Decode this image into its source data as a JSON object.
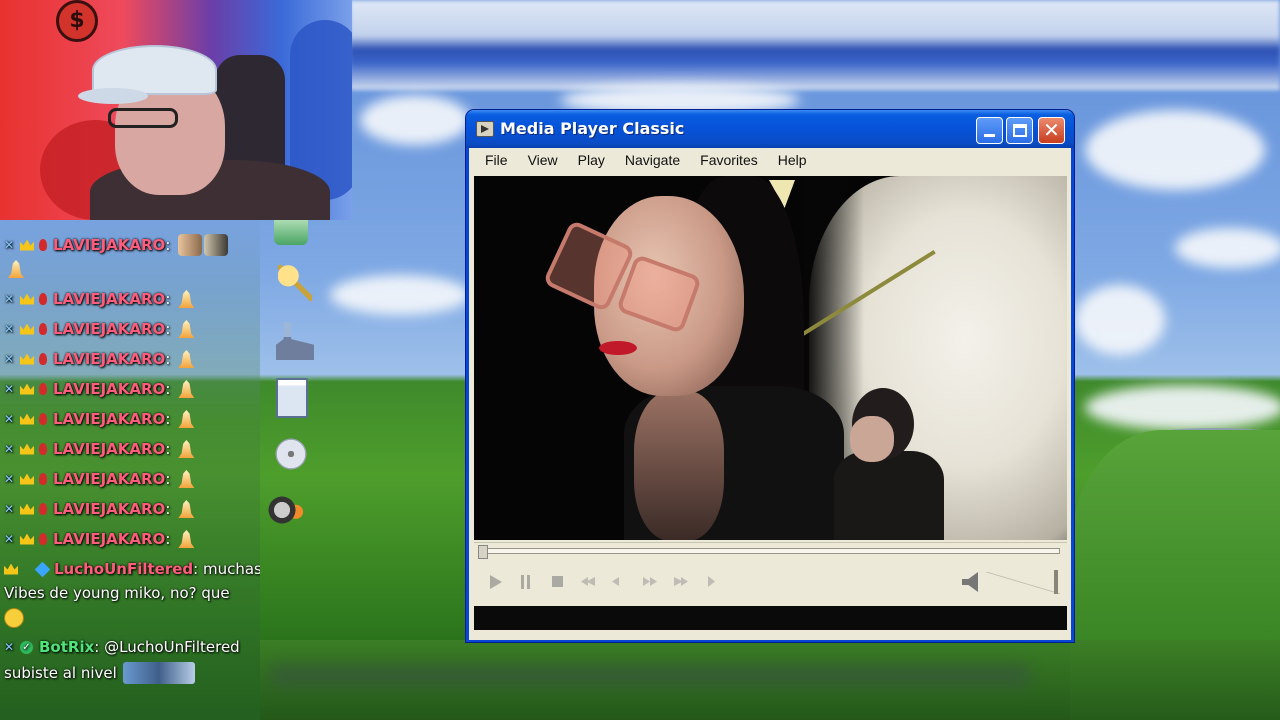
{
  "webcam": {
    "coin_symbol": "$"
  },
  "chat": {
    "messages": [
      {
        "user": "LAVIEJAKARO",
        "text": ""
      },
      {
        "user": "LAVIEJAKARO",
        "text": ""
      },
      {
        "user": "LAVIEJAKARO",
        "text": ""
      },
      {
        "user": "LAVIEJAKARO",
        "text": ""
      },
      {
        "user": "LAVIEJAKARO",
        "text": ""
      },
      {
        "user": "LAVIEJAKARO",
        "text": ""
      },
      {
        "user": "LAVIEJAKARO",
        "text": ""
      },
      {
        "user": "LAVIEJAKARO",
        "text": ""
      },
      {
        "user": "LAVIEJAKARO",
        "text": ""
      },
      {
        "user": "LAVIEJAKARO",
        "text": ""
      },
      {
        "user": "LuchoUnFiltered",
        "text": "muchas",
        "text_line2": "Vibes de young miko, no? que"
      },
      {
        "user": "BotRix",
        "text": "@LuchoUnFiltered",
        "text_line2": "subiste al nivel"
      }
    ],
    "colors": {
      "user": "#ff5b7a",
      "bot": "#50e37a"
    }
  },
  "desktop_icons": [
    "recycle-icon",
    "keys-icon",
    "phone-icon",
    "notepad-icon",
    "cd-drive-icon",
    "film-reel-icon"
  ],
  "window": {
    "title": "Media Player Classic",
    "menu": [
      "File",
      "View",
      "Play",
      "Navigate",
      "Favorites",
      "Help"
    ],
    "controls": [
      "play",
      "pause",
      "stop",
      "previous",
      "rewind",
      "fast-forward",
      "next",
      "frame-step"
    ],
    "accent": "#0a4cc7"
  }
}
